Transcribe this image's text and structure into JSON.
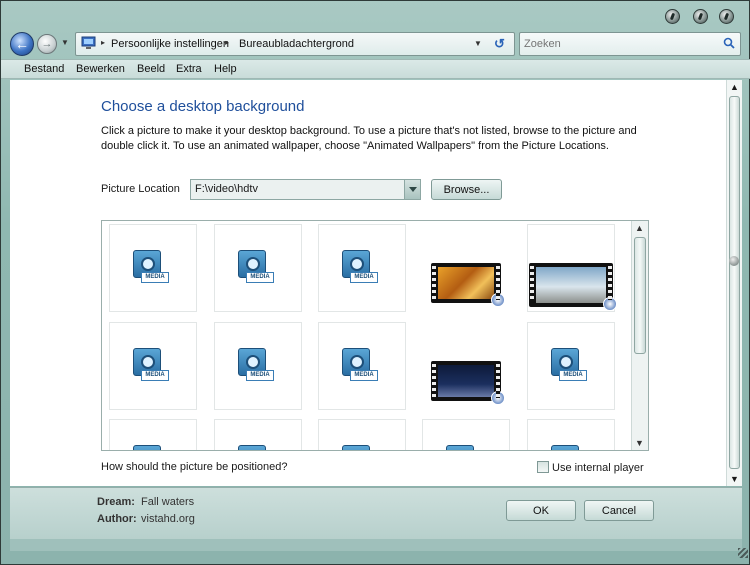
{
  "address": {
    "crumbs": [
      "Persoonlijke instellingen",
      "Bureaublad­achtergrond"
    ],
    "search_placeholder": "Zoeken"
  },
  "menu": [
    "Bestand",
    "Bewerken",
    "Beeld",
    "Extra",
    "Help"
  ],
  "main": {
    "title": "Choose a desktop background",
    "description": "Click a picture to make it your desktop background. To use a picture that's not listed, browse to the picture and double click it. To use an animated wallpaper, choose \"Animated Wallpapers\" from the Picture Locations.",
    "location_label": "Picture Location",
    "location_value": "F:\\video\\hdtv",
    "browse_label": "Browse...",
    "position_question": "How should the picture be positioned?",
    "internal_player_label": "Use internal player",
    "internal_player_checked": false,
    "media_tag": "MEDIA"
  },
  "footer": {
    "dream_label": "Dream:",
    "dream_value": "Fall waters",
    "author_label": "Author:",
    "author_value": "vistahd.org",
    "ok_label": "OK",
    "cancel_label": "Cancel"
  },
  "colors": {
    "title_blue": "#1f4f9b",
    "frame_teal": "#8fb8b1"
  }
}
